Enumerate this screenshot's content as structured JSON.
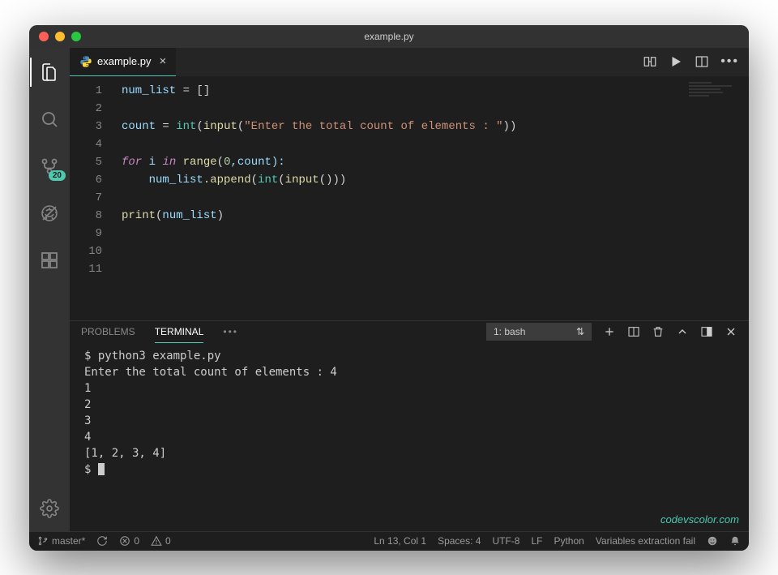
{
  "window": {
    "title": "example.py"
  },
  "tab": {
    "filename": "example.py"
  },
  "activity": {
    "badge": "20"
  },
  "code": {
    "lines": [
      "1",
      "2",
      "3",
      "4",
      "5",
      "6",
      "7",
      "8",
      "9",
      "10",
      "11"
    ],
    "l1_var": "num_list",
    "l1_rest": " = []",
    "l3_var": "count",
    "l3_eq": " = ",
    "l3_int": "int",
    "l3_input": "input",
    "l3_str": "\"Enter the total count of elements : \"",
    "l5_for": "for",
    "l5_i": " i ",
    "l5_in": "in",
    "l5_range": "range",
    "l5_args": "(",
    "l5_zero": "0",
    "l5_comma": ",count):",
    "l6_indent": "    ",
    "l6_var": "num_list",
    "l6_append": ".append",
    "l6_int": "int",
    "l6_input": "input",
    "l8_print": "print",
    "l8_arg": "num_list"
  },
  "panel": {
    "tabs": {
      "problems": "PROBLEMS",
      "terminal": "TERMINAL"
    },
    "select": "1: bash"
  },
  "terminal": {
    "l1": "$ python3 example.py",
    "l2": "Enter the total count of elements : 4",
    "l3": "1",
    "l4": "2",
    "l5": "3",
    "l6": "4",
    "l7": "[1, 2, 3, 4]",
    "l8": "$ "
  },
  "watermark": "codevscolor.com",
  "status": {
    "branch": "master*",
    "errors": "0",
    "warnings": "0",
    "ln": "Ln 13, Col 1",
    "spaces": "Spaces: 4",
    "encoding": "UTF-8",
    "eol": "LF",
    "lang": "Python",
    "msg": "Variables extraction fail"
  }
}
